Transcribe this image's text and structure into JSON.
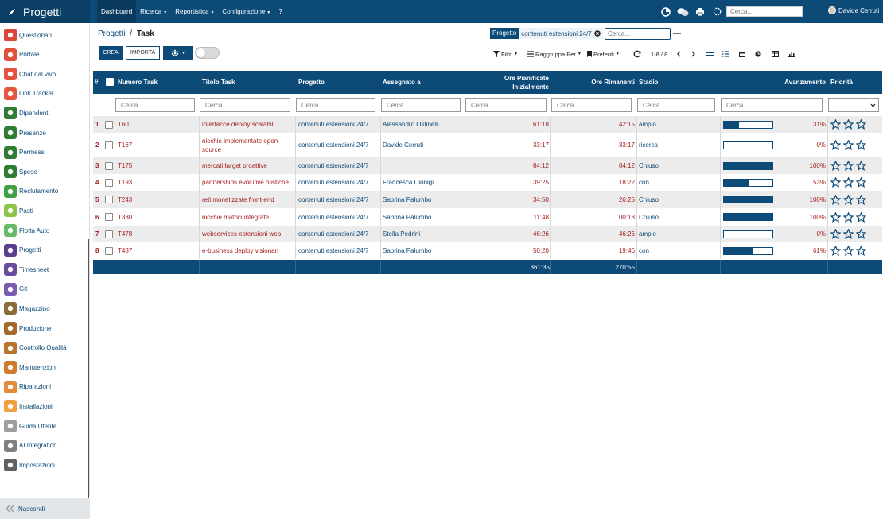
{
  "app": {
    "title": "Progetti"
  },
  "topnav": [
    {
      "label": "Dashboard",
      "dropdown": false
    },
    {
      "label": "Ricerca",
      "dropdown": true
    },
    {
      "label": "Reportistica",
      "dropdown": true
    },
    {
      "label": "Configurazione",
      "dropdown": true
    },
    {
      "label": "?",
      "dropdown": false
    }
  ],
  "topbar": {
    "search_placeholder": "Cerca...",
    "user_name": "Davide Cerruti",
    "icons": [
      "pie-chart-icon",
      "chat-icon",
      "printer-icon",
      "spinner-icon"
    ]
  },
  "sidebar": {
    "items": [
      {
        "label": "Questionari",
        "icon": "questionnaire-icon",
        "color": "#d9463b"
      },
      {
        "label": "Portale",
        "icon": "globe-icon",
        "color": "#e0503a"
      },
      {
        "label": "Chat dal vivo",
        "icon": "chat-icon",
        "color": "#e4533f"
      },
      {
        "label": "Link Tracker",
        "icon": "link-icon",
        "color": "#e6553f"
      },
      {
        "label": "Dipendenti",
        "icon": "employees-icon",
        "color": "#2e7d32"
      },
      {
        "label": "Presenze",
        "icon": "attendance-icon",
        "color": "#2e7d32"
      },
      {
        "label": "Permessi",
        "icon": "leave-icon",
        "color": "#2e7d32"
      },
      {
        "label": "Spese",
        "icon": "expenses-icon",
        "color": "#2e7d32"
      },
      {
        "label": "Reclutamento",
        "icon": "recruitment-icon",
        "color": "#43a047"
      },
      {
        "label": "Pasti",
        "icon": "meals-icon",
        "color": "#8bc34a"
      },
      {
        "label": "Flotta Auto",
        "icon": "car-icon",
        "color": "#66bb6a"
      },
      {
        "label": "Progetti",
        "icon": "puzzle-icon",
        "color": "#5c3d8f"
      },
      {
        "label": "Timesheet",
        "icon": "clock-icon",
        "color": "#6a4ba0"
      },
      {
        "label": "Git",
        "icon": "git-icon",
        "color": "#7b5bb0"
      },
      {
        "label": "Magazzino",
        "icon": "warehouse-icon",
        "color": "#8a6b3a"
      },
      {
        "label": "Produzione",
        "icon": "wrench-icon",
        "color": "#a5682a"
      },
      {
        "label": "Controllo Qualità",
        "icon": "quality-icon",
        "color": "#b8742c"
      },
      {
        "label": "Manutenzioni",
        "icon": "hammer-icon",
        "color": "#d07a2e"
      },
      {
        "label": "Riparazioni",
        "icon": "repair-icon",
        "color": "#e38b3c"
      },
      {
        "label": "Installazioni",
        "icon": "box-icon",
        "color": "#f0a040"
      },
      {
        "label": "Guida Utente",
        "icon": "guide-icon",
        "color": "#9e9e9e"
      },
      {
        "label": "AI Integration",
        "icon": "ai-icon",
        "color": "#808080"
      },
      {
        "label": "Impostazioni",
        "icon": "settings-icon",
        "color": "#616161"
      }
    ],
    "hide_label": "Nascondi"
  },
  "breadcrumb": {
    "parent": "Progetti",
    "separator": "/",
    "current": "Task"
  },
  "actions": {
    "create_label": "CREA",
    "import_label": "IMPORTA"
  },
  "search_facet": {
    "facet_label": "Progetto",
    "facet_value": "contenuti estensioni 24/7",
    "placeholder": "Cerca..."
  },
  "toolbar": {
    "filters_label": "Filtri",
    "groupby_label": "Raggruppa Per",
    "favorites_label": "Preferiti",
    "pager": "1-8 / 8"
  },
  "table": {
    "columns": {
      "idx": "#",
      "number": "Numero Task",
      "title": "Titolo Task",
      "project": "Progetto",
      "assignee": "Assegnato a",
      "planned": "Ore Pianificate Inizialmente",
      "remaining": "Ore Rimanenti",
      "stage": "Stadio",
      "progress": "Avanzamento",
      "priority": "Priorità"
    },
    "filter_placeholder": "Cerca...",
    "rows": [
      {
        "idx": "1",
        "number": "T60",
        "title": "interfacce deploy scalabili",
        "project": "contenuti estensioni 24/7",
        "assignee": "Alessandro Ostinelli",
        "planned": "61:18",
        "remaining": "42:15",
        "stage": "ampio",
        "progress": 0.31,
        "progress_text": "31%"
      },
      {
        "idx": "2",
        "number": "T167",
        "title": "nicchie implementate open-source",
        "title_line1": "nicchie implementate open-",
        "title_line2": "source",
        "project": "contenuti estensioni 24/7",
        "assignee": "Davide Cerruti",
        "planned": "33:17",
        "remaining": "33:17",
        "stage": "ricerca",
        "progress": 0.0,
        "progress_text": "0%"
      },
      {
        "idx": "3",
        "number": "T175",
        "title": "mercati target proattive",
        "project": "contenuti estensioni 24/7",
        "assignee": "",
        "planned": "84:12",
        "remaining": "84:12",
        "stage": "Chiuso",
        "progress": 1.0,
        "progress_text": "100%"
      },
      {
        "idx": "4",
        "number": "T193",
        "title": "partnerships evolutive olistiche",
        "project": "contenuti estensioni 24/7",
        "assignee": "Francesca Dionigi",
        "planned": "39:25",
        "remaining": "18:22",
        "stage": "con",
        "progress": 0.53,
        "progress_text": "53%"
      },
      {
        "idx": "5",
        "number": "T243",
        "title": "reti monetizzate front-end",
        "project": "contenuti estensioni 24/7",
        "assignee": "Sabrina Palumbo",
        "planned": "34:50",
        "remaining": "26:25",
        "stage": "Chiuso",
        "progress": 1.0,
        "progress_text": "100%"
      },
      {
        "idx": "6",
        "number": "T330",
        "title": "nicchie matrici integrate",
        "project": "contenuti estensioni 24/7",
        "assignee": "Sabrina Palumbo",
        "planned": "11:48",
        "remaining": "00:13",
        "stage": "Chiuso",
        "progress": 1.0,
        "progress_text": "100%"
      },
      {
        "idx": "7",
        "number": "T478",
        "title": "webservices estensioni web",
        "project": "contenuti estensioni 24/7",
        "assignee": "Stella Pedrini",
        "planned": "46:26",
        "remaining": "46:26",
        "stage": "ampio",
        "progress": 0.0,
        "progress_text": "0%"
      },
      {
        "idx": "8",
        "number": "T487",
        "title": "e-business deploy visionari",
        "project": "contenuti estensioni 24/7",
        "assignee": "Sabrina Palumbo",
        "planned": "50:20",
        "remaining": "19:46",
        "stage": "con",
        "progress": 0.61,
        "progress_text": "61%"
      }
    ],
    "totals": {
      "planned": "361:35",
      "remaining": "270:55"
    }
  },
  "colors": {
    "brand": "#0c4a78",
    "accent_red": "#a61d1d",
    "row_alt": "#ececec"
  }
}
